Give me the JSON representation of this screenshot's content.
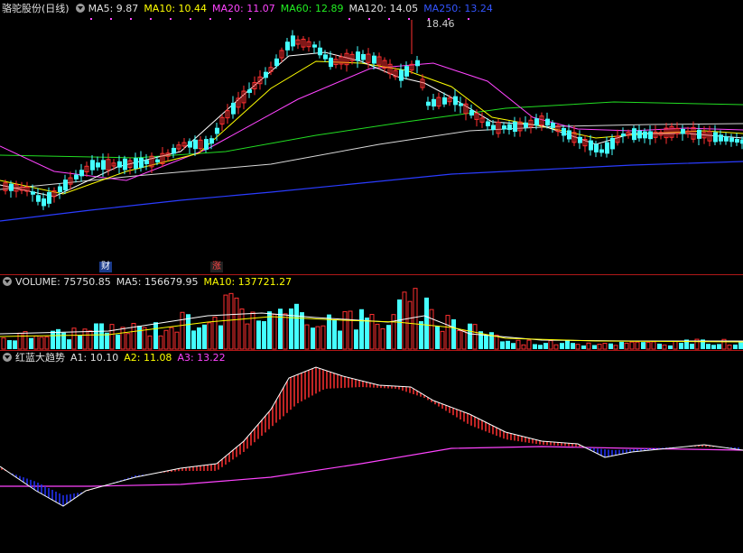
{
  "price_panel": {
    "stock_name": "骆驼股份",
    "period": "(日线)",
    "ma": [
      {
        "label": "MA5: 9.87",
        "color": "#e0e0e0"
      },
      {
        "label": "MA10: 10.44",
        "color": "#ffff00"
      },
      {
        "label": "MA20: 11.07",
        "color": "#ff44ff"
      },
      {
        "label": "MA60: 12.89",
        "color": "#22ee22"
      },
      {
        "label": "MA120: 14.05",
        "color": "#e0e0e0"
      },
      {
        "label": "MA250: 13.24",
        "color": "#3355ff"
      }
    ],
    "high_label": "18.46",
    "events": [
      {
        "text": "财",
        "color": "#ffffff",
        "bg": "#1a3a8a"
      },
      {
        "text": "涨",
        "color": "#ff4444",
        "bg": "#222222"
      }
    ]
  },
  "volume_panel": {
    "title": "VOLUME: 75750.85",
    "ma5": "MA5: 156679.95",
    "ma10": "MA10: 137721.27",
    "up_color": "#ff3030",
    "down_color": "#44ffff"
  },
  "indicator_panel": {
    "name": "红蓝大趋势",
    "a1": "A1: 10.10",
    "a2": "A2: 11.08",
    "a3": "A3: 13.22"
  },
  "colors": {
    "up": "#ff3030",
    "down": "#44ffff",
    "bg": "#000000",
    "separator": "#b01818"
  }
}
